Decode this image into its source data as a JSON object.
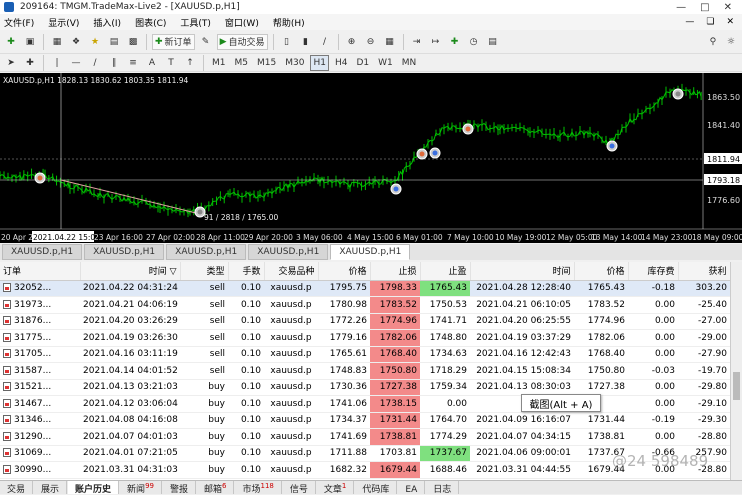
{
  "window": {
    "title": "209164: TMGM.TradeMax-Live2 - [XAUUSD.p,H1]"
  },
  "menu": [
    "文件(F)",
    "显示(V)",
    "插入(I)",
    "图表(C)",
    "工具(T)",
    "窗口(W)",
    "帮助(H)"
  ],
  "toolbar": {
    "new_order": "新订单",
    "auto_trading": "自动交易",
    "timeframes": [
      "M1",
      "M5",
      "M15",
      "M30",
      "H1",
      "H4",
      "D1",
      "W1",
      "MN"
    ],
    "active_timeframe": "H1"
  },
  "chart": {
    "header": "XAUUSD.p,H1  1828.13 1830.62 1803.35 1811.94",
    "price_labels": [
      "1863.50",
      "1841.40",
      "1811.94",
      "1793.18",
      "1776.60"
    ],
    "time_labels": [
      "20 Apr 20",
      "2021.04.22 15:00",
      "23 Apr 16:00",
      "27 Apr 02:00",
      "28 Apr 11:00",
      "29 Apr 20:00",
      "3 May 06:00",
      "4 May 15:00",
      "6 May 01:00",
      "7 May 10:00",
      "10 May 19:00",
      "12 May 05:00",
      "13 May 14:00",
      "14 May 23:00",
      "18 May 09:00"
    ],
    "annotation": "91 / 2818 / 1765.00"
  },
  "chart_tabs": [
    "XAUUSD.p,H1",
    "XAUUSD.p,H1",
    "XAUUSD.p,H1",
    "XAUUSD.p,H1",
    "XAUUSD.p,H1"
  ],
  "columns": [
    "订单",
    "时间",
    "类型",
    "手数",
    "交易品种",
    "价格",
    "止损",
    "止盈",
    "时间",
    "价格",
    "库存费",
    "获利"
  ],
  "orders": [
    [
      "32052...",
      "2021.04.22 04:31:24",
      "sell",
      "0.10",
      "xauusd.p",
      "1795.75",
      "1798.33",
      "1765.43",
      "2021.04.28 12:28:40",
      "1765.43",
      "-0.18",
      "303.20"
    ],
    [
      "31973...",
      "2021.04.21 04:06:19",
      "sell",
      "0.10",
      "xauusd.p",
      "1780.98",
      "1783.52",
      "1750.53",
      "2021.04.21 06:10:05",
      "1783.52",
      "0.00",
      "-25.40"
    ],
    [
      "31876...",
      "2021.04.20 03:26:29",
      "sell",
      "0.10",
      "xauusd.p",
      "1772.26",
      "1774.96",
      "1741.71",
      "2021.04.20 06:25:55",
      "1774.96",
      "0.00",
      "-27.00"
    ],
    [
      "31775...",
      "2021.04.19 03:26:30",
      "sell",
      "0.10",
      "xauusd.p",
      "1779.16",
      "1782.06",
      "1748.80",
      "2021.04.19 03:37:29",
      "1782.06",
      "0.00",
      "-29.00"
    ],
    [
      "31705...",
      "2021.04.16 03:11:19",
      "sell",
      "0.10",
      "xauusd.p",
      "1765.61",
      "1768.40",
      "1734.63",
      "2021.04.16 12:42:43",
      "1768.40",
      "0.00",
      "-27.90"
    ],
    [
      "31587...",
      "2021.04.14 04:01:52",
      "sell",
      "0.10",
      "xauusd.p",
      "1748.83",
      "1750.80",
      "1718.29",
      "2021.04.15 15:08:34",
      "1750.80",
      "-0.03",
      "-19.70"
    ],
    [
      "31521...",
      "2021.04.13 03:21:03",
      "buy",
      "0.10",
      "xauusd.p",
      "1730.36",
      "1727.38",
      "1759.34",
      "2021.04.13 08:30:03",
      "1727.38",
      "0.00",
      "-29.80"
    ],
    [
      "31467...",
      "2021.04.12 03:06:04",
      "buy",
      "0.10",
      "xauusd.p",
      "1741.06",
      "1738.15",
      "0.00",
      "",
      "",
      "0.00",
      "-29.10"
    ],
    [
      "31346...",
      "2021.04.08 04:16:08",
      "buy",
      "0.10",
      "xauusd.p",
      "1734.37",
      "1731.44",
      "1764.70",
      "2021.04.09 16:16:07",
      "1731.44",
      "-0.19",
      "-29.30"
    ],
    [
      "31290...",
      "2021.04.07 04:01:03",
      "buy",
      "0.10",
      "xauusd.p",
      "1741.69",
      "1738.81",
      "1774.29",
      "2021.04.07 04:34:15",
      "1738.81",
      "0.00",
      "-28.80"
    ],
    [
      "31069...",
      "2021.04.01 07:21:05",
      "buy",
      "0.10",
      "xauusd.p",
      "1711.88",
      "1703.81",
      "1737.67",
      "2021.04.06 09:00:01",
      "1737.67",
      "-0.66",
      "257.90"
    ],
    [
      "30990...",
      "2021.03.31 04:31:03",
      "buy",
      "0.10",
      "xauusd.p",
      "1682.32",
      "1679.44",
      "1688.46",
      "2021.03.31 04:44:55",
      "1679.44",
      "0.00",
      "-28.80"
    ]
  ],
  "tooltip": "截图(Alt + A)",
  "watermark": "@24 598489",
  "bottom_tabs": [
    {
      "label": "交易",
      "badge": ""
    },
    {
      "label": "展示",
      "badge": ""
    },
    {
      "label": "账户历史",
      "badge": ""
    },
    {
      "label": "新闻",
      "badge": "99"
    },
    {
      "label": "警报",
      "badge": ""
    },
    {
      "label": "邮箱",
      "badge": "6"
    },
    {
      "label": "市场",
      "badge": "118"
    },
    {
      "label": "信号",
      "badge": ""
    },
    {
      "label": "文章",
      "badge": "1"
    },
    {
      "label": "代码库",
      "badge": ""
    },
    {
      "label": "EA",
      "badge": ""
    },
    {
      "label": "日志",
      "badge": ""
    }
  ],
  "colors": {
    "stop_loss": "#f38a8a",
    "take_profit": "#7fe07f",
    "candles": "#00c000",
    "chart_bg": "#000000"
  }
}
